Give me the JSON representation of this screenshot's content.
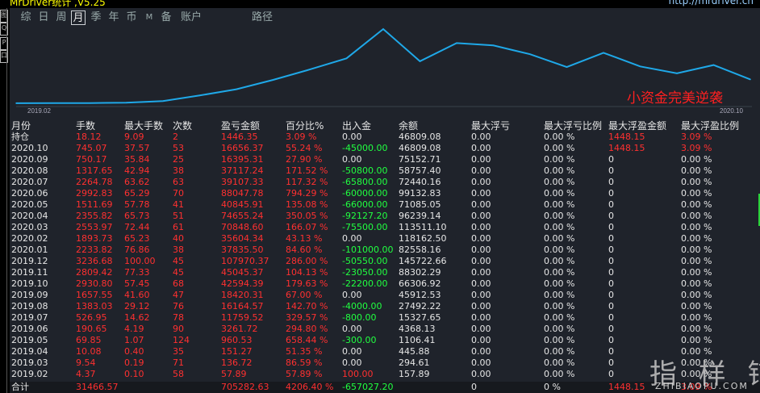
{
  "app": {
    "title": "MrDriver统计 ,V5.25",
    "url": "http://mrdriver.cn"
  },
  "left_buttons": [
    "图",
    "Q",
    "P",
    "口"
  ],
  "tabs": [
    "综",
    "日",
    "周",
    "月",
    "季",
    "年",
    "币",
    "M",
    "备",
    "账户",
    "路径"
  ],
  "active_tab": "月",
  "chart": {
    "x_start_label": "2019.02",
    "x_end_label": "2020.10",
    "annotation": "小资金完美逆袭",
    "line_color": "#1fa8e8"
  },
  "chart_data": {
    "type": "line",
    "x": [
      "2019.02",
      "2019.03",
      "2019.04",
      "2019.05",
      "2019.06",
      "2019.07",
      "2019.08",
      "2019.09",
      "2019.10",
      "2019.11",
      "2019.12",
      "2020.01",
      "2020.02",
      "2020.03",
      "2020.04",
      "2020.05",
      "2020.06",
      "2020.07",
      "2020.08",
      "2020.09",
      "2020.10"
    ],
    "series": [
      {
        "values": [
          157.89,
          294.61,
          445.88,
          1106.41,
          4368.13,
          15327.65,
          27492.22,
          45912.53,
          66306.92,
          88302.29,
          145722.66,
          82558.16,
          118162.5,
          113511.1,
          96239.14,
          71085.05,
          99132.83,
          72440.16,
          58757.4,
          75152.71,
          46809.08
        ]
      }
    ]
  },
  "table": {
    "headers": [
      "月份",
      "手数",
      "最大手数",
      "次数",
      "盈亏金额",
      "百分比%",
      "出入金",
      "余额",
      "最大浮亏",
      "最大浮亏比例",
      "最大浮盈金额",
      "最大浮盈比例"
    ],
    "rows": [
      [
        "持仓",
        "18.12",
        "9.09",
        "2",
        "1446.35",
        "3.09 %",
        "0.00",
        "46809.08",
        "0.00",
        "0.00 %",
        "1448.15",
        "3.09 %"
      ],
      [
        "2020.10",
        "745.07",
        "37.57",
        "53",
        "16656.37",
        "55.24 %",
        "-45000.00",
        "46809.08",
        "0.00",
        "0.00 %",
        "1448.15",
        "3.09 %"
      ],
      [
        "2020.09",
        "750.17",
        "35.84",
        "25",
        "16395.31",
        "27.90 %",
        "0.00",
        "75152.71",
        "0.00",
        "0.00 %",
        "0",
        "0.00 %"
      ],
      [
        "2020.08",
        "1317.65",
        "42.94",
        "38",
        "37117.24",
        "171.52 %",
        "-50800.00",
        "58757.40",
        "0.00",
        "0.00 %",
        "0",
        "0.00 %"
      ],
      [
        "2020.07",
        "2264.78",
        "63.62",
        "63",
        "39107.33",
        "117.32 %",
        "-65800.00",
        "72440.16",
        "0.00",
        "0.00 %",
        "0",
        "0.00 %"
      ],
      [
        "2020.06",
        "2992.83",
        "65.29",
        "70",
        "88047.78",
        "794.29 %",
        "-60000.00",
        "99132.83",
        "0.00",
        "0.00 %",
        "0",
        "0.00 %"
      ],
      [
        "2020.05",
        "1511.69",
        "57.78",
        "41",
        "40845.91",
        "135.08 %",
        "-66000.00",
        "71085.05",
        "0.00",
        "0.00 %",
        "0",
        "0.00 %"
      ],
      [
        "2020.04",
        "2355.82",
        "65.73",
        "51",
        "74655.24",
        "350.05 %",
        "-92127.20",
        "96239.14",
        "0.00",
        "0.00 %",
        "0",
        "0.00 %"
      ],
      [
        "2020.03",
        "2553.97",
        "72.44",
        "61",
        "70848.60",
        "166.07 %",
        "-75500.00",
        "113511.10",
        "0.00",
        "0.00 %",
        "0",
        "0.00 %"
      ],
      [
        "2020.02",
        "1893.73",
        "65.23",
        "40",
        "35604.34",
        "43.13 %",
        "0.00",
        "118162.50",
        "0.00",
        "0.00 %",
        "0",
        "0.00 %"
      ],
      [
        "2020.01",
        "2233.82",
        "76.86",
        "38",
        "37835.50",
        "84.60 %",
        "-101000.00",
        "82558.16",
        "0.00",
        "0.00 %",
        "0",
        "0.00 %"
      ],
      [
        "2019.12",
        "3236.68",
        "100.00",
        "45",
        "107970.37",
        "286.00 %",
        "-50550.00",
        "145722.66",
        "0.00",
        "0.00 %",
        "0",
        "0.00 %"
      ],
      [
        "2019.11",
        "2809.42",
        "77.33",
        "45",
        "45045.37",
        "104.13 %",
        "-23050.00",
        "88302.29",
        "0.00",
        "0.00 %",
        "0",
        "0.00 %"
      ],
      [
        "2019.10",
        "2930.80",
        "57.45",
        "68",
        "42594.39",
        "179.63 %",
        "-22200.00",
        "66306.92",
        "0.00",
        "0.00 %",
        "0",
        "0.00 %"
      ],
      [
        "2019.09",
        "1657.55",
        "41.60",
        "47",
        "18420.31",
        "67.00 %",
        "0.00",
        "45912.53",
        "0.00",
        "0.00 %",
        "0",
        "0.00 %"
      ],
      [
        "2019.08",
        "1383.03",
        "29.12",
        "76",
        "16164.57",
        "142.70 %",
        "-4000.00",
        "27492.22",
        "0.00",
        "0.00 %",
        "0",
        "0.00 %"
      ],
      [
        "2019.07",
        "526.95",
        "14.62",
        "78",
        "11759.52",
        "329.57 %",
        "-800.00",
        "15327.65",
        "0.00",
        "0.00 %",
        "0",
        "0.00 %"
      ],
      [
        "2019.06",
        "190.65",
        "4.19",
        "90",
        "3261.72",
        "294.80 %",
        "0.00",
        "4368.13",
        "0.00",
        "0.00 %",
        "0",
        "0.00 %"
      ],
      [
        "2019.05",
        "69.85",
        "1.07",
        "124",
        "960.53",
        "658.44 %",
        "-300.00",
        "1106.41",
        "0.00",
        "0.00 %",
        "0",
        "0.00 %"
      ],
      [
        "2019.04",
        "10.08",
        "0.40",
        "35",
        "151.27",
        "51.35 %",
        "0.00",
        "445.88",
        "0.00",
        "0.00 %",
        "0",
        "0.00 %"
      ],
      [
        "2019.03",
        "9.54",
        "0.19",
        "71",
        "136.72",
        "86.59 %",
        "0.00",
        "294.61",
        "0.00",
        "0.00 %",
        "0",
        "0.00 %"
      ],
      [
        "2019.02",
        "4.37",
        "0.10",
        "58",
        "57.89",
        "57.89 %",
        "100.00",
        "157.89",
        "0.00",
        "0.00 %",
        "0",
        "0.00 %"
      ]
    ],
    "total": [
      "合计",
      "31466.57",
      "",
      "",
      "705282.63",
      "4206.40 %",
      "-657027.20",
      "",
      "0",
      "0 %",
      "1448.15",
      "3.09 %"
    ]
  },
  "watermark": {
    "text": "指 样 铺",
    "sub": "ZHIBIAOPU.COM"
  }
}
